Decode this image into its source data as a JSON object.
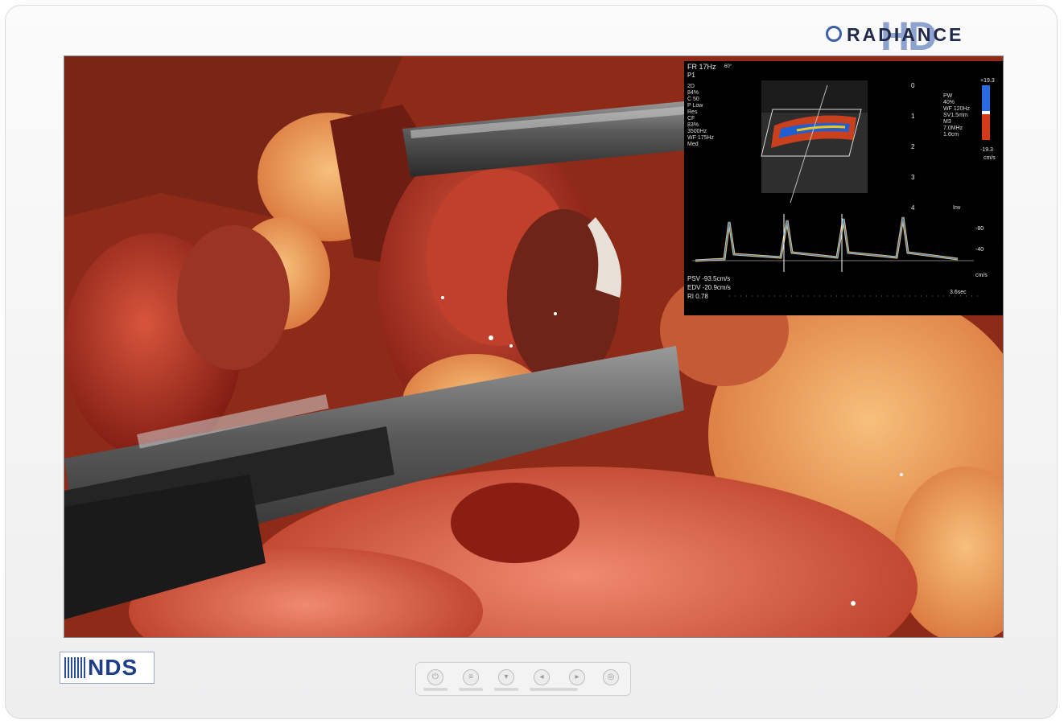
{
  "brand": {
    "hd": "HD",
    "name": "RADIANCE"
  },
  "logo": {
    "name": "NDS"
  },
  "ultrasound": {
    "header": "FR 17Hz",
    "angle": "60°",
    "p": "P1",
    "mode_2d": [
      "2D",
      "84%",
      "C 50",
      "P Low",
      "Res"
    ],
    "cf": [
      "CF",
      "83%",
      "3500Hz",
      "WF 175Hz",
      "Med"
    ],
    "pw": [
      "PW",
      "40%",
      "WF 120Hz",
      "SV1.5mm",
      "M3",
      "7.0MHz",
      "1.6cm"
    ],
    "scale_top": "+19.3",
    "scale_bottom": "-19.3",
    "scale_unit": "cm/s",
    "depth_ticks": [
      "0",
      "1",
      "2",
      "3",
      "4"
    ],
    "inv": "Inv",
    "doppler_ticks": [
      "-80",
      "-40"
    ],
    "doppler_unit": "cm/s",
    "psv": "PSV -93.5cm/s",
    "edv": "EDV -20.9cm/s",
    "ri": "RI 0.78",
    "duration": "3.6sec"
  },
  "colors": {
    "bezel": "#f4f4f5",
    "brand_blue": "#2c4d9a",
    "tissue": "#b8432a"
  }
}
